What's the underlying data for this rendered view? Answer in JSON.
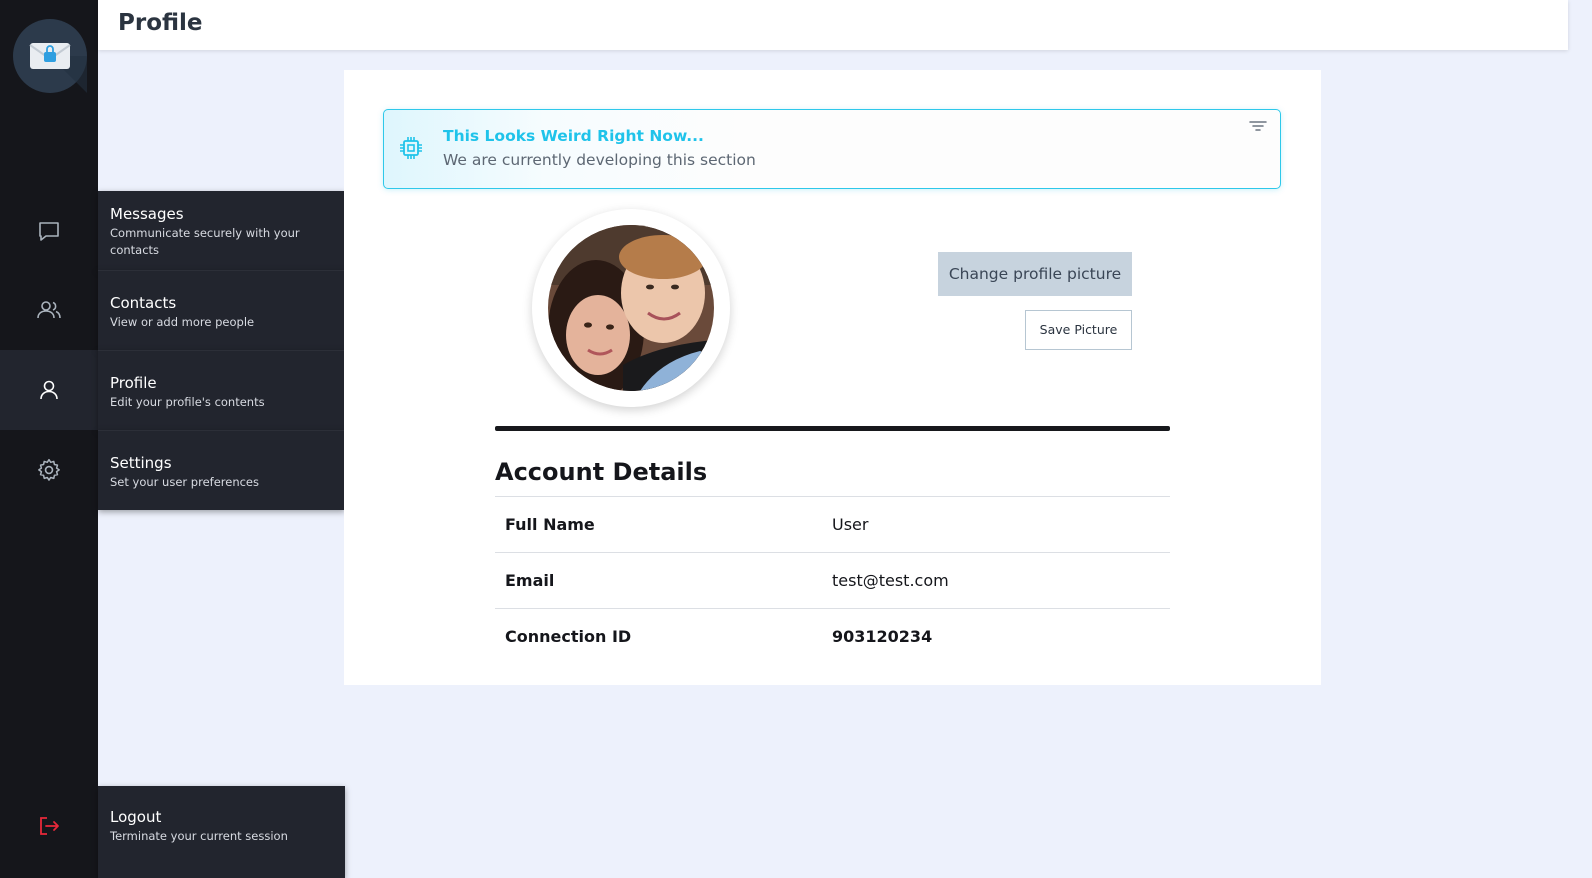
{
  "header": {
    "title": "Profile"
  },
  "nav": {
    "items": [
      {
        "title": "Messages",
        "desc": "Communicate securely with your contacts"
      },
      {
        "title": "Contacts",
        "desc": "View or add more people"
      },
      {
        "title": "Profile",
        "desc": "Edit your profile's contents"
      },
      {
        "title": "Settings",
        "desc": "Set your user preferences"
      }
    ],
    "logout": {
      "title": "Logout",
      "desc": "Terminate your current session"
    }
  },
  "notice": {
    "title": "This Looks Weird Right Now...",
    "text": "We are currently developing this section"
  },
  "profile": {
    "change_picture_label": "Change profile picture",
    "save_picture_label": "Save Picture"
  },
  "account": {
    "title": "Account Details",
    "rows": [
      {
        "label": "Full Name",
        "value": "User"
      },
      {
        "label": "Email",
        "value": "test@test.com"
      },
      {
        "label": "Connection ID",
        "value": "903120234"
      }
    ]
  },
  "colors": {
    "rail": "#15161b",
    "flyout": "#22252e",
    "accent": "#1fc3ea",
    "logout": "#e8283a",
    "page_bg": "#edf1fc"
  },
  "icons": [
    "mail-lock-icon",
    "chat-icon",
    "contacts-icon",
    "user-icon",
    "gear-icon",
    "logout-icon",
    "cpu-icon",
    "filter-icon"
  ]
}
